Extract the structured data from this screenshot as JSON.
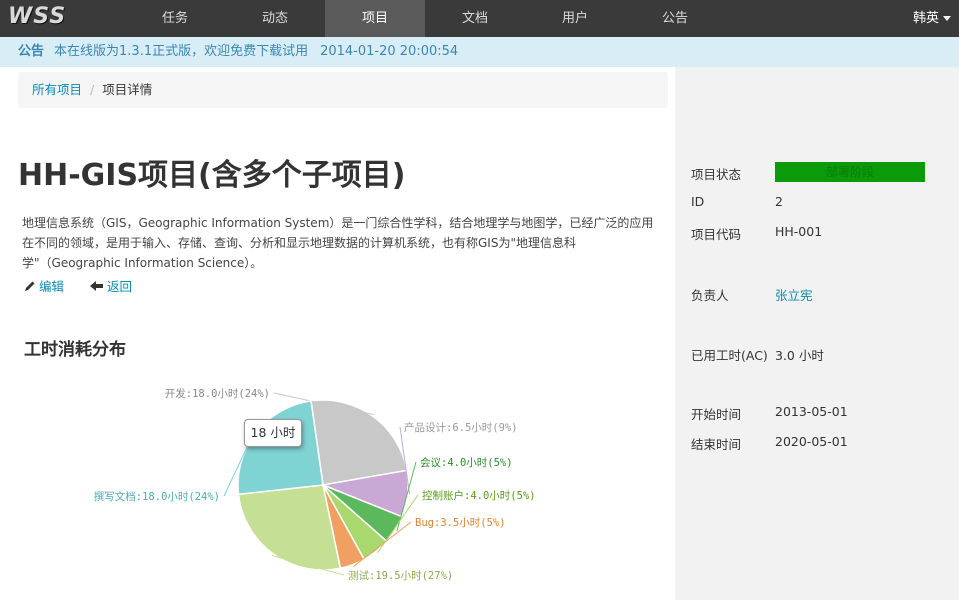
{
  "app": {
    "logo": "WSS"
  },
  "nav": {
    "items": [
      {
        "label": "任务"
      },
      {
        "label": "动态"
      },
      {
        "label": "项目",
        "active": true
      },
      {
        "label": "文档"
      },
      {
        "label": "用户"
      },
      {
        "label": "公告"
      }
    ],
    "user": "韩英"
  },
  "notice": {
    "label": "公告",
    "text": "本在线版为1.3.1正式版，欢迎免费下载试用",
    "time": "2014-01-20 20:00:54"
  },
  "breadcrumb": {
    "root": "所有项目",
    "separator": "/",
    "current": "项目详情"
  },
  "project": {
    "title": "HH-GIS项目(含多个子项目)",
    "description": "地理信息系统（GIS，Geographic Information System）是一门综合性学科，结合地理学与地图学，已经广泛的应用在不同的领域，是用于输入、存储、查询、分析和显示地理数据的计算机系统，也有称GIS为\"地理信息科学\"（Geographic Information Science）。",
    "edit_label": "编辑",
    "back_label": "返回"
  },
  "section_title": "工时消耗分布",
  "tooltip": "18 小时",
  "properties": {
    "status_label": "项目状态",
    "status_value": "部署阶段",
    "status_color": "#0a9a0a",
    "id_label": "ID",
    "id_value": "2",
    "code_label": "项目代码",
    "code_value": "HH-001",
    "owner_label": "负责人",
    "owner_value": "张立宪",
    "ac_label": "已用工时(AC)",
    "ac_value": "3.0 小时",
    "start_label": "开始时间",
    "start_value": "2013-05-01",
    "end_label": "结束时间",
    "end_value": "2020-05-01"
  },
  "chart_data": {
    "type": "pie",
    "slices": [
      {
        "label": "开发:18.0小时(24%)",
        "value": 18.0,
        "color": "#c8c8c8",
        "text_color": "#888888"
      },
      {
        "label": "产品设计:6.5小时(9%)",
        "value": 6.5,
        "color": "#c9a8d6",
        "text_color": "#999999"
      },
      {
        "label": "会议:4.0小时(5%)",
        "value": 4.0,
        "color": "#5cb85c",
        "text_color": "#2e8b2e"
      },
      {
        "label": "控制账户:4.0小时(5%)",
        "value": 4.0,
        "color": "#a9d86e",
        "text_color": "#5a9a1a"
      },
      {
        "label": "Bug:3.5小时(5%)",
        "value": 3.5,
        "color": "#f0a060",
        "text_color": "#e08030"
      },
      {
        "label": "测试:19.5小时(27%)",
        "value": 19.5,
        "color": "#c5e095",
        "text_color": "#8aaa50"
      },
      {
        "label": "撰写文档:18.0小时(24%)",
        "value": 18.0,
        "color": "#7fd3d3",
        "text_color": "#4aabb0"
      }
    ]
  }
}
